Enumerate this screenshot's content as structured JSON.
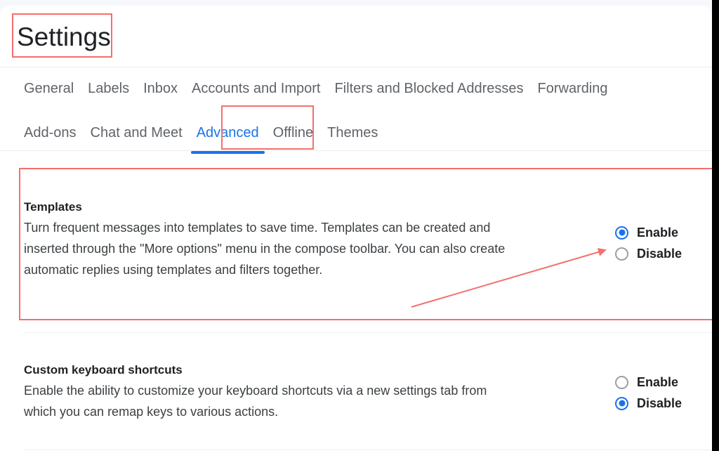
{
  "header": {
    "title": "Settings"
  },
  "tabs_row1": [
    {
      "label": "General",
      "active": false
    },
    {
      "label": "Labels",
      "active": false
    },
    {
      "label": "Inbox",
      "active": false
    },
    {
      "label": "Accounts and Import",
      "active": false
    },
    {
      "label": "Filters and Blocked Addresses",
      "active": false
    },
    {
      "label": "Forwarding",
      "active": false
    }
  ],
  "tabs_row2": [
    {
      "label": "Add-ons",
      "active": false
    },
    {
      "label": "Chat and Meet",
      "active": false
    },
    {
      "label": "Advanced",
      "active": true
    },
    {
      "label": "Offline",
      "active": false
    },
    {
      "label": "Themes",
      "active": false
    }
  ],
  "sections": [
    {
      "id": "templates",
      "title": "Templates",
      "description": "Turn frequent messages into templates to save time. Templates can be created and inserted through the \"More options\" menu in the compose toolbar. You can also create automatic replies using templates and filters together.",
      "options": [
        {
          "label": "Enable",
          "selected": true
        },
        {
          "label": "Disable",
          "selected": false
        }
      ]
    },
    {
      "id": "custom-keyboard-shortcuts",
      "title": "Custom keyboard shortcuts",
      "description": "Enable the ability to customize your keyboard shortcuts via a new settings tab from which you can remap keys to various actions.",
      "options": [
        {
          "label": "Enable",
          "selected": false
        },
        {
          "label": "Disable",
          "selected": true
        }
      ]
    }
  ],
  "colors": {
    "accent_blue": "#1a73e8",
    "annotation_red": "#f2706e",
    "text_primary": "#202124",
    "text_secondary": "#5f6368",
    "page_background": "#f6f8fc",
    "card_background": "#ffffff",
    "gutter": "#000000"
  },
  "annotations": {
    "title_box": "Settings",
    "tab_box": "Advanced",
    "section_box": "Templates",
    "arrow_target": "Disable"
  }
}
